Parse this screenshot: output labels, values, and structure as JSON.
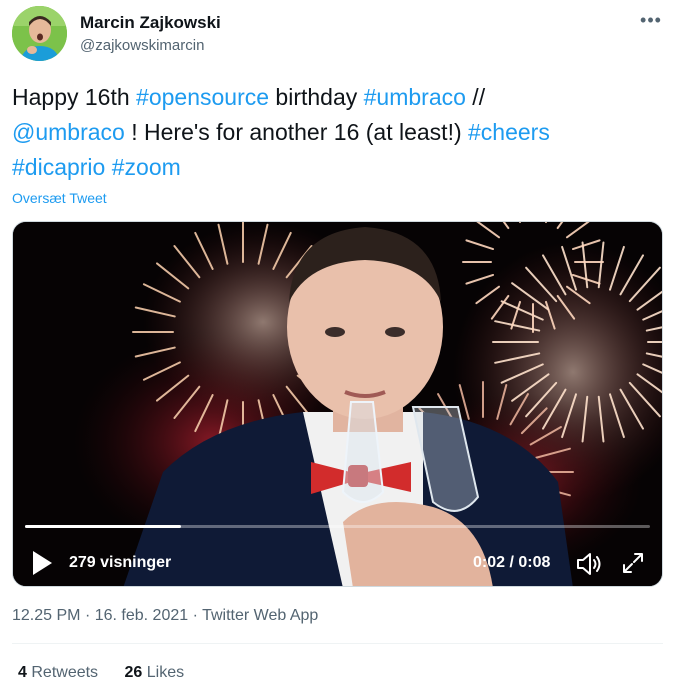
{
  "author": {
    "name": "Marcin Zajkowski",
    "handle": "@zajkowskimarcin"
  },
  "tweet": {
    "segments": [
      {
        "text": "Happy 16th ",
        "link": false
      },
      {
        "text": "#opensource",
        "link": true
      },
      {
        "text": " birthday ",
        "link": false
      },
      {
        "text": "#umbraco",
        "link": true
      },
      {
        "text": " //\n",
        "link": false
      },
      {
        "text": "@umbraco",
        "link": true
      },
      {
        "text": " ! Here's for another 16 (at least!) ",
        "link": false
      },
      {
        "text": "#cheers",
        "link": true
      },
      {
        "text": "\n",
        "link": false
      },
      {
        "text": "#dicaprio",
        "link": true
      },
      {
        "text": " ",
        "link": false
      },
      {
        "text": "#zoom",
        "link": true
      }
    ],
    "translate_label": "Oversæt Tweet"
  },
  "video": {
    "views_label": "279 visninger",
    "time_label": "0:02 / 0:08",
    "progress": 0.25
  },
  "meta": {
    "time": "12.25 PM",
    "separator": "·",
    "date": "16. feb. 2021",
    "app": "Twitter Web App"
  },
  "stats": {
    "retweets_count": "4",
    "retweets_label": "Retweets",
    "likes_count": "26",
    "likes_label": "Likes"
  },
  "colors": {
    "link": "#1d9bf0",
    "secondary_text": "#536471",
    "primary_text": "#0f1419"
  },
  "icons": {
    "more": "more-horizontal-icon",
    "play": "play-icon",
    "volume": "volume-icon",
    "fullscreen": "fullscreen-icon"
  }
}
